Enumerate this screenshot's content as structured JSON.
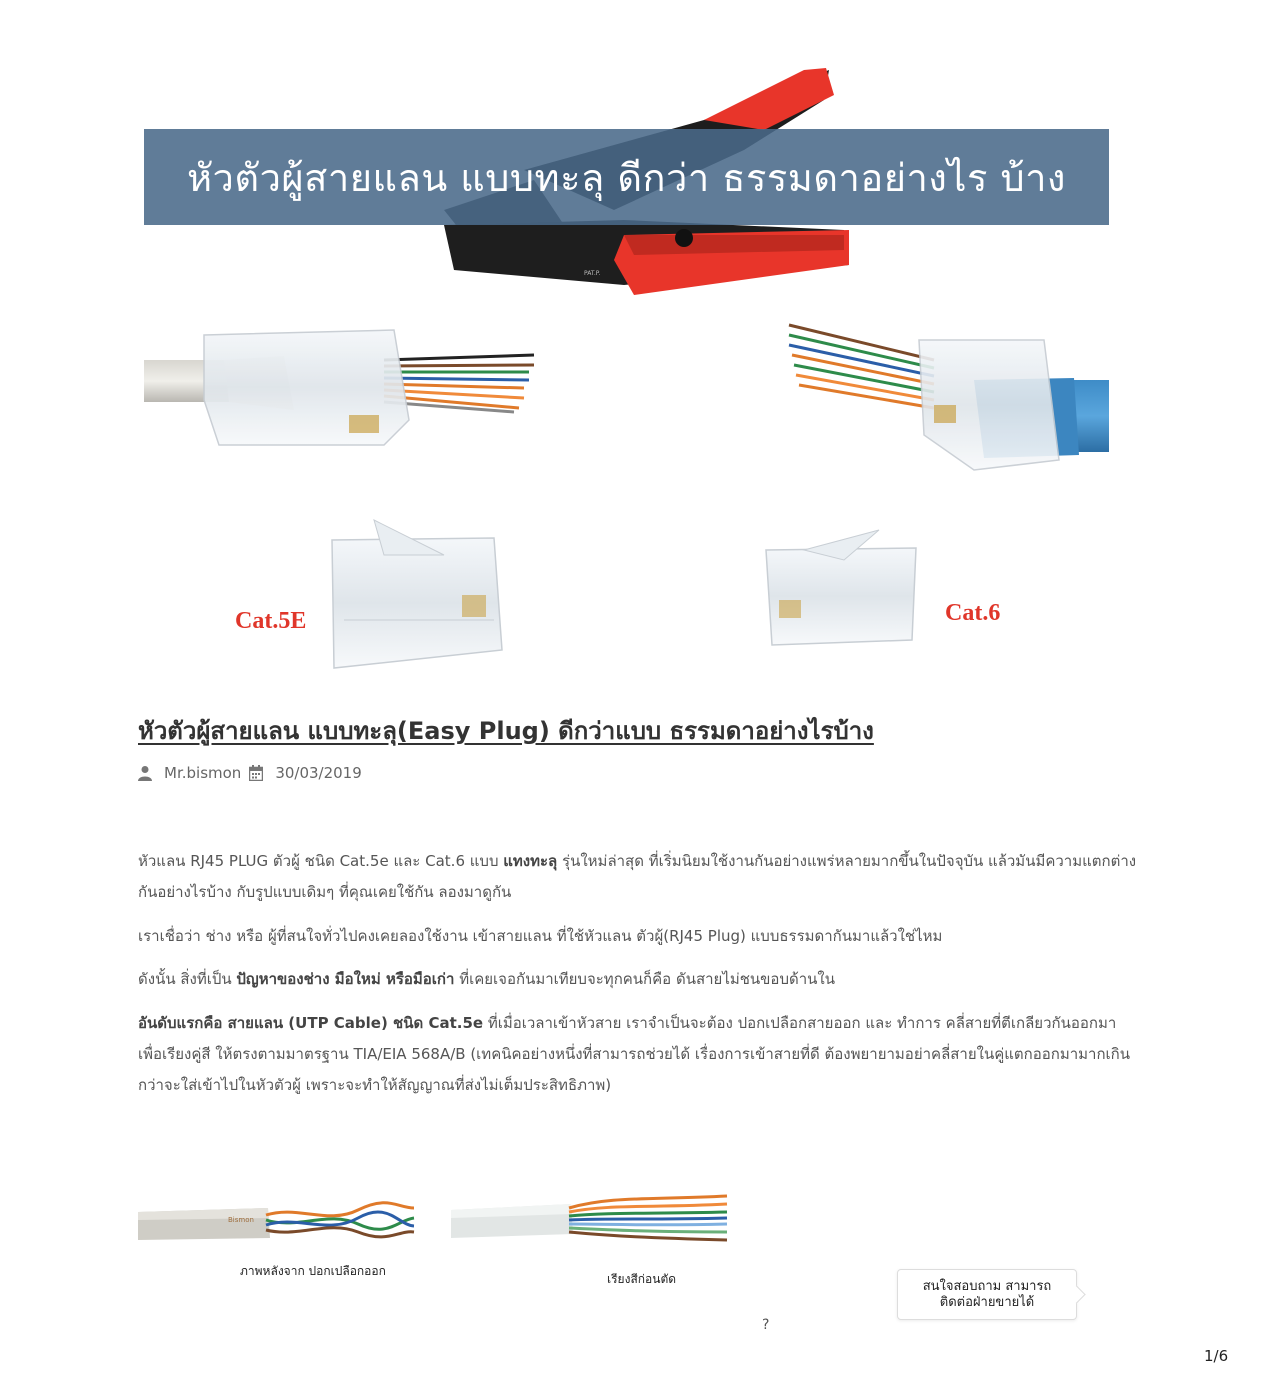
{
  "hero": {
    "banner_text": "หัวตัวผู้สายแลน แบบทะลุ ดีกว่า ธรรมดาอย่างไร บ้าง",
    "cat5e_label": "Cat.5E",
    "cat6_label": "Cat.6",
    "tool_label": "PAT.P.",
    "colors": {
      "banner": "#4a6a8a",
      "label_red": "#e0362a",
      "handle_red": "#e8352a"
    }
  },
  "article": {
    "title": "หัวตัวผู้สายแลน แบบทะลุ(Easy Plug) ดีกว่าแบบ ธรรมดาอย่างไรบ้าง",
    "author": "Mr.bismon",
    "date": "30/03/2019",
    "p1_a": "หัวแลน RJ45 PLUG ตัวผู้ ชนิด Cat.5e และ Cat.6 แบบ ",
    "p1_bold": "แทงทะลุ",
    "p1_b": " รุ่นใหม่ล่าสุด ที่เริ่มนิยมใช้งานกันอย่างแพร่หลายมากขึ้นในปัจจุบัน แล้วมันมีความแตกต่างกันอย่างไรบ้าง กับรูปแบบเดิมๆ ที่คุณเคยใช้กัน ลองมาดูกัน",
    "p2": "เราเชื่อว่า ช่าง หรือ ผู้ที่สนใจทั่วไปคงเคยลองใช้งาน เข้าสายแลน ที่ใช้หัวแลน ตัวผู้(RJ45 Plug) แบบธรรมดากันมาแล้วใช่ไหม",
    "p3_a": "ดังนั้น สิ่งที่เป็น ",
    "p3_bold": "ปัญหาของช่าง มือใหม่ หรือมือเก่า",
    "p3_b": " ที่เคยเจอกันมาเทียบจะทุกคนก็คือ ดันสายไม่ชนขอบด้านใน",
    "p4_bold": "อันดับแรกคือ สายแลน (UTP Cable) ชนิด Cat.5e",
    "p4_b": "  ที่เมื่อเวลาเข้าหัวสาย เราจำเป็นจะต้อง ปอกเปลือกสายออก และ ทำการ คลี่สายที่ตีเกลียวกันออกมา เพื่อเรียงคู่สี ให้ตรงตามมาตรฐาน TIA/EIA 568A/B (เทคนิคอย่างหนึ่งที่สามารถช่วยได้ เรื่องการเข้าสายที่ดี ต้องพยายามอย่าคลี่สายในคู่แตกออกมามากเกินกว่าจะใส่เข้าไปในหัวตัวผู้ เพราะจะทำให้สัญญาณที่ส่งไม่เต็มประสิทธิภาพ)"
  },
  "figures": {
    "caption1": "ภาพหลังจาก ปอกเปลือกออก",
    "caption2": "เรียงสีก่อนตัด",
    "cable_brand": "Bismon"
  },
  "chat": {
    "line1": "สนใจสอบถาม สามารถ",
    "line2": "ติดต่อฝ่ายขายได้"
  },
  "misc": {
    "question_mark": "?",
    "page_number": "1/6"
  }
}
